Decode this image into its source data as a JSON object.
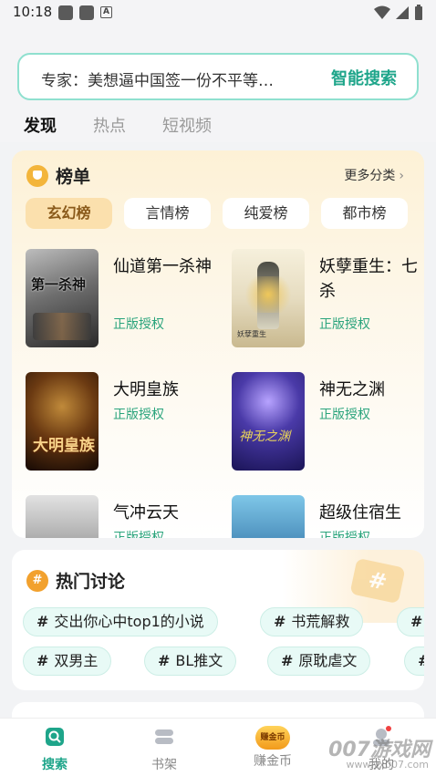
{
  "status_bar": {
    "time": "10:18"
  },
  "search": {
    "text": "专家：美想逼中国签一份不平等…",
    "button": "智能搜索"
  },
  "tabs": [
    {
      "label": "发现",
      "active": true
    },
    {
      "label": "热点",
      "active": false
    },
    {
      "label": "短视频",
      "active": false
    }
  ],
  "ranking": {
    "title": "榜单",
    "more": "更多分类",
    "categories": [
      "玄幻榜",
      "言情榜",
      "纯爱榜",
      "都市榜"
    ],
    "books": [
      {
        "title": "仙道第一杀神",
        "tag": "正版授权",
        "cover_text": "第一杀神"
      },
      {
        "title": "妖孽重生：七杀",
        "tag": "正版授权",
        "cover_text": "妖孽重生"
      },
      {
        "title": "大明皇族",
        "tag": "正版授权",
        "cover_text": "大明皇族"
      },
      {
        "title": "神无之渊",
        "tag": "正版授权",
        "cover_text": "神无之渊"
      },
      {
        "title": "气冲云天",
        "tag": "正版授权",
        "cover_text": ""
      },
      {
        "title": "超级住宿生",
        "tag": "正版授权",
        "cover_text": ""
      }
    ]
  },
  "hot": {
    "title": "热门讨论",
    "topics": [
      "交出你心中top1的小说",
      "书荒解救",
      "双男主",
      "BL推文",
      "原耽虐文"
    ]
  },
  "nav": [
    {
      "label": "搜索",
      "active": true
    },
    {
      "label": "书架",
      "active": false
    },
    {
      "label": "赚金币",
      "active": false
    },
    {
      "label": "我的",
      "active": false
    }
  ],
  "coin_badge": "赚金币",
  "watermark": {
    "text": "007游戏网",
    "url": "www.yx007.com"
  },
  "colors": {
    "accent": "#1ea58a",
    "tag_green": "#2aa47c",
    "rank_pill_active": "#fbe0ad"
  }
}
